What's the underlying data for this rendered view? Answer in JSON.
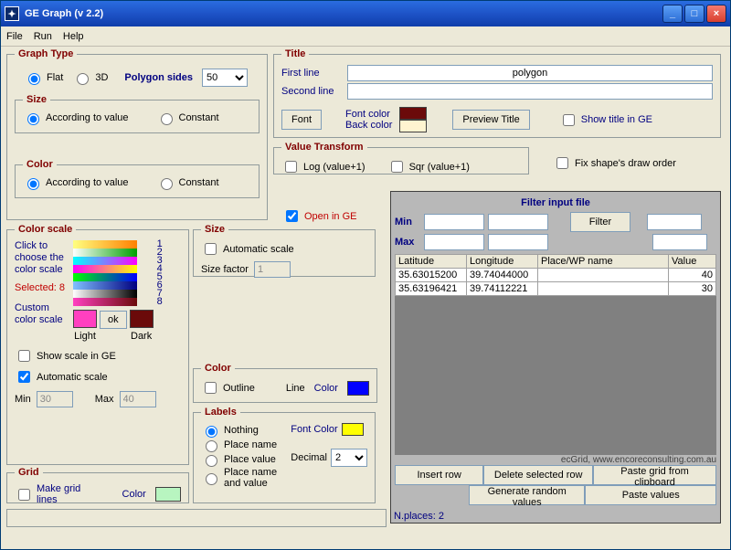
{
  "window": {
    "title": "GE Graph (v 2.2)"
  },
  "menu": {
    "file": "File",
    "run": "Run",
    "help": "Help"
  },
  "graphType": {
    "legend": "Graph Type",
    "flat": "Flat",
    "threeD": "3D",
    "polygonSidesLabel": "Polygon sides",
    "polygonSides": "50",
    "sizeLegend": "Size",
    "accToValue": "According to value",
    "constant": "Constant",
    "colorLegend": "Color"
  },
  "colorScale": {
    "legend": "Color scale",
    "clickText": "Click to choose the color scale",
    "selected": "Selected: 8",
    "custom": "Custom color scale",
    "light": "Light",
    "dark": "Dark",
    "okBtn": "ok",
    "showScale": "Show scale in GE",
    "autoScale": "Automatic scale",
    "minLbl": "Min",
    "minVal": "30",
    "maxLbl": "Max",
    "maxVal": "40",
    "swatchNumbers": [
      "1",
      "2",
      "3",
      "4",
      "5",
      "6",
      "7",
      "8"
    ]
  },
  "grid": {
    "legend": "Grid",
    "make": "Make grid lines",
    "colorLbl": "Color",
    "swatch": "#b8f5c0"
  },
  "size": {
    "legend": "Size",
    "auto": "Automatic scale",
    "factorLbl": "Size factor",
    "factorVal": "1"
  },
  "colorPanel": {
    "legend": "Color",
    "outline": "Outline",
    "lineLbl": "Line",
    "lineColorLbl": "Color",
    "lineSwatch": "#0000ff"
  },
  "labels": {
    "legend": "Labels",
    "nothing": "Nothing",
    "placeName": "Place name",
    "placeValue": "Place value",
    "placeBoth": "Place name and value",
    "fontColorLbl": "Font Color",
    "fontSwatch": "#ffff00",
    "decimalLbl": "Decimal",
    "decimalVal": "2"
  },
  "titlePanel": {
    "legend": "Title",
    "firstLine": "First line",
    "secondLine": "Second line",
    "firstVal": "polygon",
    "secondVal": "",
    "fontBtn": "Font",
    "fontColorLbl": "Font color",
    "backColorLbl": "Back color",
    "fontSwatch": "#6b0a0a",
    "backSwatch": "#fff4d0",
    "previewBtn": "Preview Title",
    "showTitle": "Show title in GE"
  },
  "valueTransform": {
    "legend": "Value Transform",
    "log": "Log (value+1)",
    "sqr": "Sqr (value+1)",
    "fixDraw": "Fix shape's draw order"
  },
  "openGE": "Open in GE",
  "filter": {
    "legend": "Filter input file",
    "min": "Min",
    "max": "Max",
    "filterBtn": "Filter",
    "headers": [
      "Latitude",
      "Longitude",
      "Place/WP name",
      "Value"
    ],
    "rows": [
      {
        "lat": "35.63015200",
        "lon": "39.74044000",
        "name": "",
        "val": "40"
      },
      {
        "lat": "35.63196421",
        "lon": "39.74112221",
        "name": "",
        "val": "30"
      }
    ],
    "credit": "ecGrid,  www.encoreconsulting.com.au",
    "btnInsert": "Insert row",
    "btnDelete": "Delete selected row",
    "btnPasteClip": "Paste grid from clipboard",
    "btnRandom": "Generate random values",
    "btnPasteVals": "Paste values",
    "nplaces": "N.places: 2"
  }
}
